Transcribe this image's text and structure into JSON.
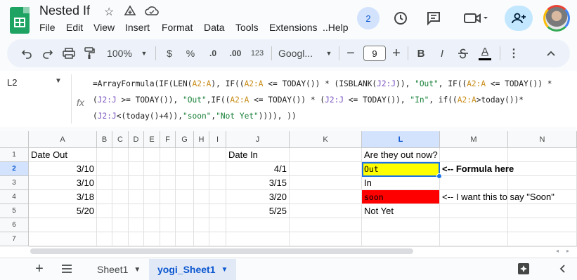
{
  "doc": {
    "title": "Nested If"
  },
  "menu": [
    "File",
    "Edit",
    "View",
    "Insert",
    "Format",
    "Data",
    "Tools",
    "Extensions",
    "..Help"
  ],
  "header": {
    "collaborator_count": "2"
  },
  "toolbar": {
    "zoom": "100%",
    "currency": "$",
    "percent": "%",
    "decrease_decimal": ".0",
    "increase_decimal": ".00",
    "number_format": "123",
    "font": "Googl...",
    "font_size": "9",
    "bold": "B",
    "italic": "I",
    "text_color": "A"
  },
  "formula_bar": {
    "name_box": "L2",
    "fx": "fx",
    "parts": [
      {
        "t": "=ArrayFormula(IF(LEN(",
        "c": "plain"
      },
      {
        "t": "A2:A",
        "c": "rng"
      },
      {
        "t": "), IF((",
        "c": "plain"
      },
      {
        "t": "A2:A",
        "c": "rng"
      },
      {
        "t": " <= TODAY()) * (ISBLANK(",
        "c": "plain"
      },
      {
        "t": "J2:J",
        "c": "rng2"
      },
      {
        "t": ")), ",
        "c": "plain"
      },
      {
        "t": "\"Out\"",
        "c": "str"
      },
      {
        "t": ", IF((",
        "c": "plain"
      },
      {
        "t": "A2:A",
        "c": "rng"
      },
      {
        "t": " <= TODAY()) * (",
        "c": "plain"
      },
      {
        "t": "J2:J",
        "c": "rng2"
      },
      {
        "t": " >= TODAY()), ",
        "c": "plain"
      },
      {
        "t": "\"Out\"",
        "c": "str"
      },
      {
        "t": ",IF((",
        "c": "plain"
      },
      {
        "t": "A2:A",
        "c": "rng"
      },
      {
        "t": " <= TODAY()) * (",
        "c": "plain"
      },
      {
        "t": "J2:J",
        "c": "rng2"
      },
      {
        "t": " <= TODAY()), ",
        "c": "plain"
      },
      {
        "t": "\"In\"",
        "c": "str"
      },
      {
        "t": ", if((",
        "c": "plain"
      },
      {
        "t": "A2:A",
        "c": "rng"
      },
      {
        "t": ">today())*(",
        "c": "plain"
      },
      {
        "t": "J2:J",
        "c": "rng2"
      },
      {
        "t": "<(today()+4)),",
        "c": "plain"
      },
      {
        "t": "\"soon\"",
        "c": "str"
      },
      {
        "t": ",",
        "c": "plain"
      },
      {
        "t": "\"Not Yet\"",
        "c": "str"
      },
      {
        "t": ")))), ))",
        "c": "plain"
      }
    ]
  },
  "columns": [
    "A",
    "B",
    "C",
    "D",
    "E",
    "F",
    "G",
    "H",
    "I",
    "J",
    "K",
    "L",
    "M",
    "N"
  ],
  "rows": [
    "1",
    "2",
    "3",
    "4",
    "5",
    "6",
    "7"
  ],
  "cells": {
    "A1": "Date Out",
    "A2": "3/10",
    "A3": "3/10",
    "A4": "3/18",
    "A5": "5/20",
    "J1": "Date In",
    "J2": "4/1",
    "J3": "3/15",
    "J4": "3/20",
    "J5": "5/25",
    "L1": "Are they out now?",
    "L2": "Out",
    "L3": "In",
    "L4": "soon",
    "L5": "Not Yet",
    "M2": "<-- Formula here",
    "M4": "<-- I want this to say \"Soon\""
  },
  "colors": {
    "L2_fill": "#ffff00",
    "L4_fill": "#ff0000",
    "selection": "#1a73e8",
    "sheets_green": "#1ea362"
  },
  "sheets": [
    {
      "name": "Sheet1",
      "active": false
    },
    {
      "name": "yogi_Sheet1",
      "active": true
    }
  ],
  "icons": [
    "star-icon",
    "move-to-drive-icon",
    "cloud-saved-icon",
    "history-icon",
    "comment-icon",
    "meet-icon",
    "share-icon",
    "undo-icon",
    "redo-icon",
    "print-icon",
    "paint-format-icon",
    "more-icon",
    "collapse-icon",
    "add-sheet-icon",
    "all-sheets-icon",
    "explore-icon",
    "side-panel-icon"
  ]
}
